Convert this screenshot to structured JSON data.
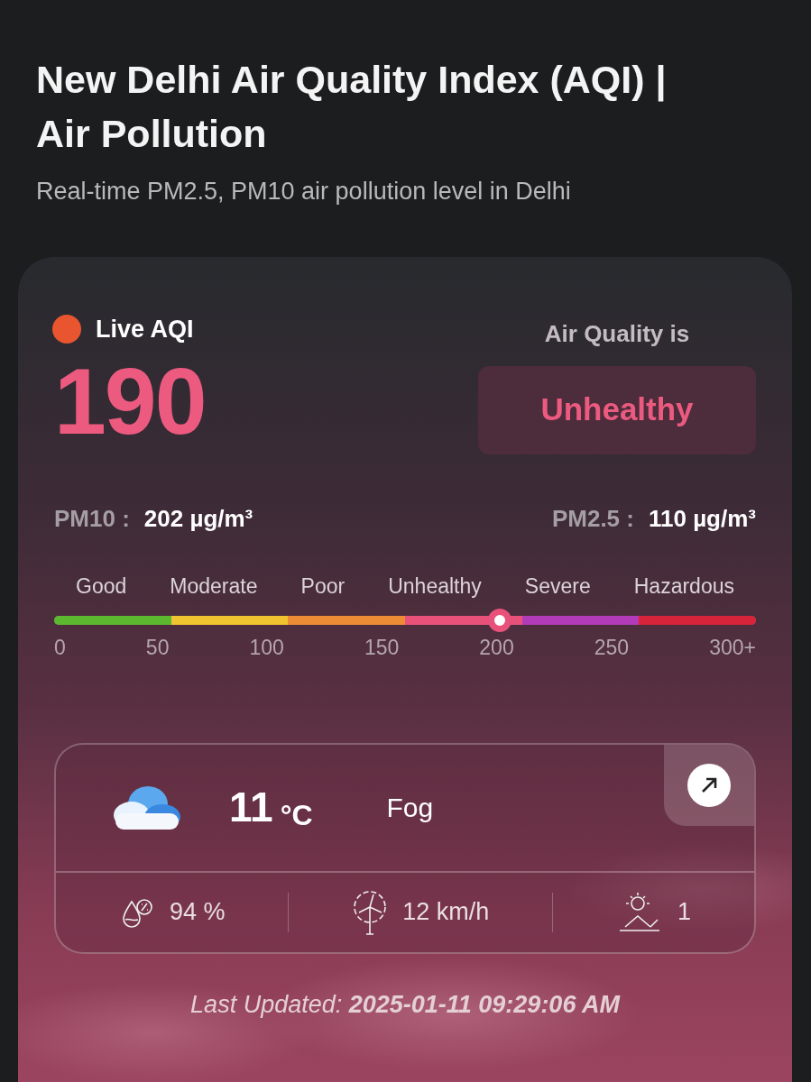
{
  "page": {
    "title": "New Delhi Air Quality Index (AQI) | Air Pollution",
    "subtitle": "Real-time PM2.5, PM10 air pollution level in Delhi"
  },
  "aqi_card": {
    "live_label": "Live AQI",
    "value": "190",
    "status_label": "Air Quality is",
    "status": "Unhealthy",
    "pm": [
      {
        "label": "PM10 :",
        "value": "202 µg/m³"
      },
      {
        "label": "PM2.5 :",
        "value": "110 µg/m³"
      }
    ],
    "scale": {
      "categories": [
        {
          "label": "Good",
          "color": "#5cb82e"
        },
        {
          "label": "Moderate",
          "color": "#f0c330"
        },
        {
          "label": "Poor",
          "color": "#ec8c34"
        },
        {
          "label": "Unhealthy",
          "color": "#e8527a"
        },
        {
          "label": "Severe",
          "color": "#b13bb8"
        },
        {
          "label": "Hazardous",
          "color": "#d8243a"
        }
      ],
      "ticks": [
        "0",
        "50",
        "100",
        "150",
        "200",
        "250",
        "300+"
      ],
      "marker": {
        "level": 0.635
      }
    },
    "weather": {
      "temperature": "11",
      "unit": "°C",
      "condition": "Fog",
      "stats": [
        {
          "kind": "humidity",
          "value": "94 %"
        },
        {
          "kind": "wind",
          "value": "12 km/h"
        },
        {
          "kind": "uv",
          "value": "1"
        }
      ]
    },
    "last_updated": {
      "label": "Last Updated:",
      "value": "2025-01-11 09:29:06 AM"
    }
  }
}
